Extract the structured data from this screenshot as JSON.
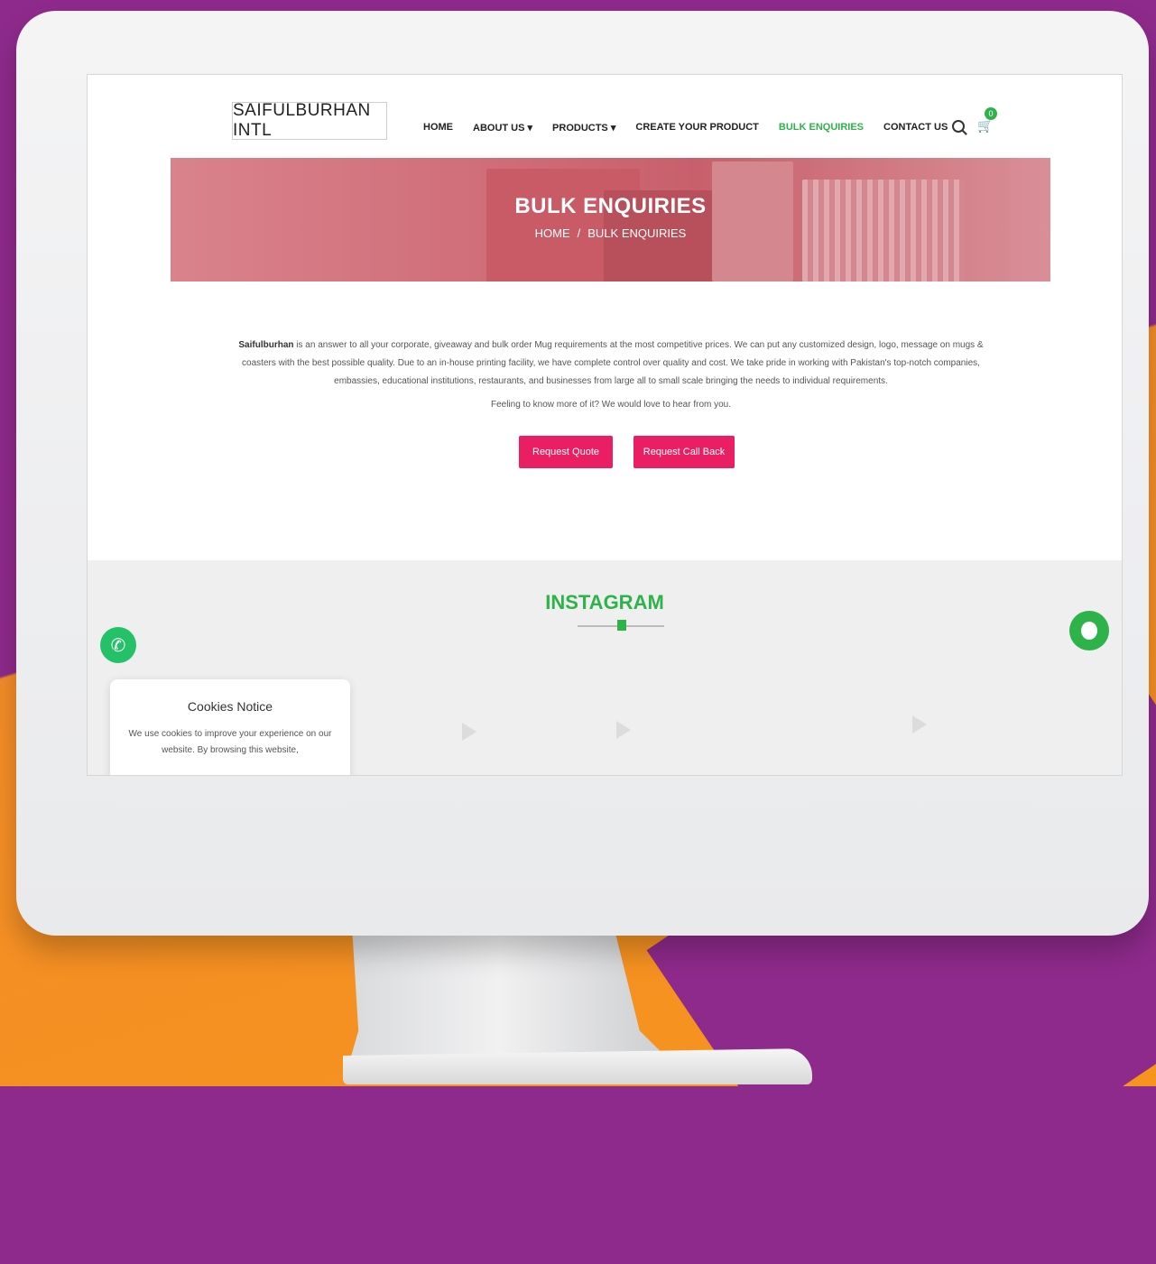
{
  "header": {
    "logo_text": "SAIFULBURHAN INTL",
    "nav": [
      {
        "label": "HOME"
      },
      {
        "label": "ABOUT US"
      },
      {
        "label": "PRODUCTS"
      },
      {
        "label": "CREATE YOUR PRODUCT"
      },
      {
        "label": "BULK ENQUIRIES",
        "active": true
      },
      {
        "label": "CONTACT US"
      }
    ],
    "cart_count": "0"
  },
  "banner": {
    "title": "BULK ENQUIRIES",
    "breadcrumb_home": "HOME",
    "breadcrumb_sep": "/",
    "breadcrumb_current": "BULK ENQUIRIES"
  },
  "main": {
    "intro_brand": "Saifulburhan",
    "intro_text": " is an answer to all your corporate, giveaway and bulk order Mug requirements at the most competitive prices. We can put any customized design, logo, message on mugs & coasters with the best possible quality. Due to an in-house printing facility, we have complete control over quality and cost. We take pride in working with Pakistan's top-notch companies, embassies, educational institutions, restaurants, and businesses from large all to small scale bringing the needs to individual requirements.",
    "feeling_text": "Feeling to know more of it? We would love to hear from you.",
    "buttons": {
      "request_quote": "Request Quote",
      "request_call_back": "Request Call Back"
    }
  },
  "instagram": {
    "title": "INSTAGRAM"
  },
  "cookies": {
    "title": "Cookies Notice",
    "text": "We use cookies to improve your experience on our website. By browsing this website,"
  },
  "colors": {
    "accent_green": "#2eb34a",
    "button_pink": "#e91e63",
    "background_purple": "#8e2a8b",
    "background_orange": "#f7941d"
  }
}
